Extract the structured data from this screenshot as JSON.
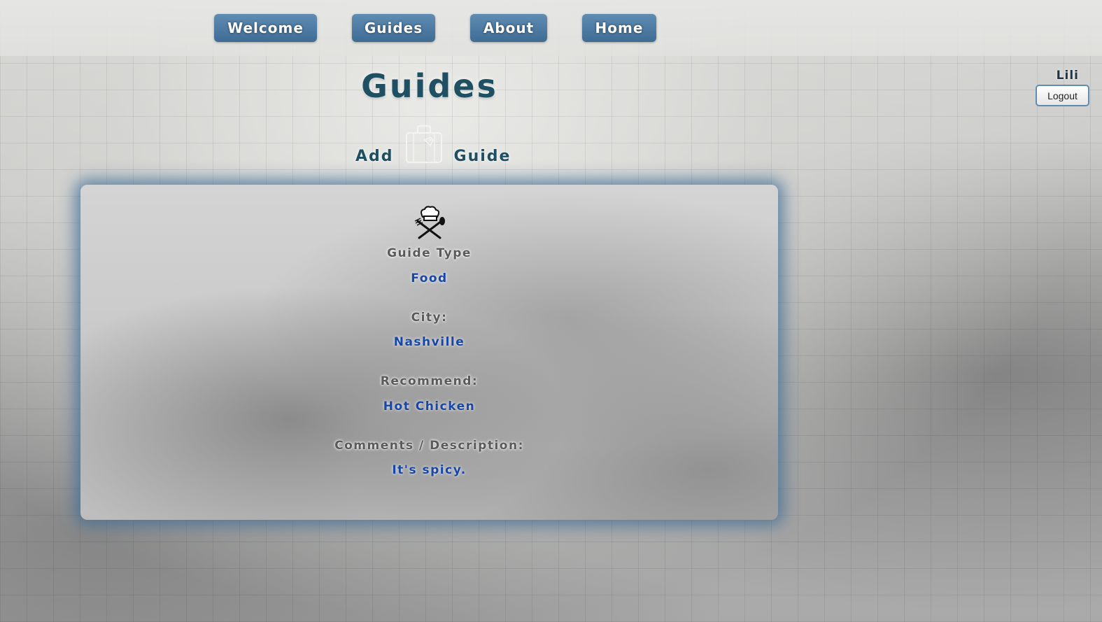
{
  "nav": {
    "items": [
      {
        "label": "Welcome"
      },
      {
        "label": "Guides"
      },
      {
        "label": "About"
      },
      {
        "label": "Home"
      }
    ]
  },
  "user": {
    "name": "Lili",
    "logout_label": "Logout"
  },
  "page": {
    "title": "Guides"
  },
  "add_guide": {
    "word1": "Add",
    "word2": "Guide",
    "icon": "suitcase-icon"
  },
  "guide": {
    "icon": "chef-icon",
    "type_label": "Guide Type",
    "type_value": "Food",
    "city_label": "City:",
    "city_value": "Nashville",
    "recommend_label": "Recommend:",
    "recommend_value": "Hot Chicken",
    "comments_label": "Comments / Description:",
    "comments_value": "It's spicy."
  },
  "colors": {
    "nav_button": "#4a78a2",
    "title": "#1f4f63",
    "value_text": "#1747a8",
    "card_glow": "#3e6c96"
  }
}
